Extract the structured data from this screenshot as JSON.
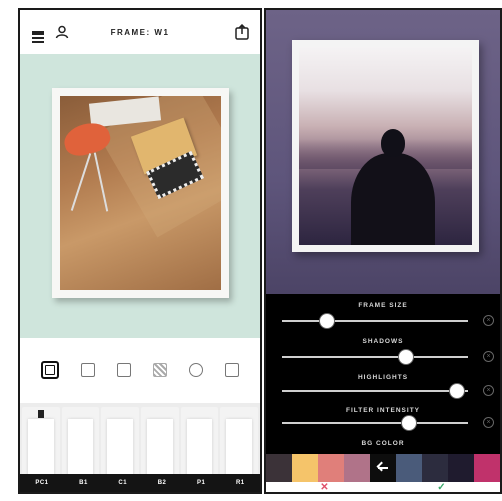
{
  "left_screen": {
    "header": {
      "title": "FRAME: W1"
    },
    "toolbar": {
      "icons": [
        "frame-icon",
        "tag-icon",
        "brush-icon",
        "pattern-icon",
        "circle-icon",
        "more-icon"
      ]
    },
    "frame_options": [
      "PC1",
      "B1",
      "C1",
      "B2",
      "P1",
      "R1"
    ],
    "colors": {
      "mint": "#cfe5dc",
      "bar": "#141414"
    }
  },
  "right_screen": {
    "sliders": [
      {
        "label": "FRAME SIZE",
        "value": 0.22
      },
      {
        "label": "SHADOWS",
        "value": 0.68
      },
      {
        "label": "HIGHLIGHTS",
        "value": 0.98
      },
      {
        "label": "FILTER INTENSITY",
        "value": 0.7
      }
    ],
    "bg_color_label": "BG COLOR",
    "bg_colors": [
      "#3b3238",
      "#f5c46a",
      "#e07f7a",
      "#b07389",
      "#0d0d0d",
      "#4a5b7a",
      "#2c2c3e",
      "#1f1b2e",
      "#c0326b"
    ],
    "selected_bg_index": 4,
    "actions": {
      "cancel": "✕",
      "confirm": "✓"
    },
    "colors": {
      "cancel": "#e0506a",
      "confirm": "#3aa86b"
    }
  }
}
